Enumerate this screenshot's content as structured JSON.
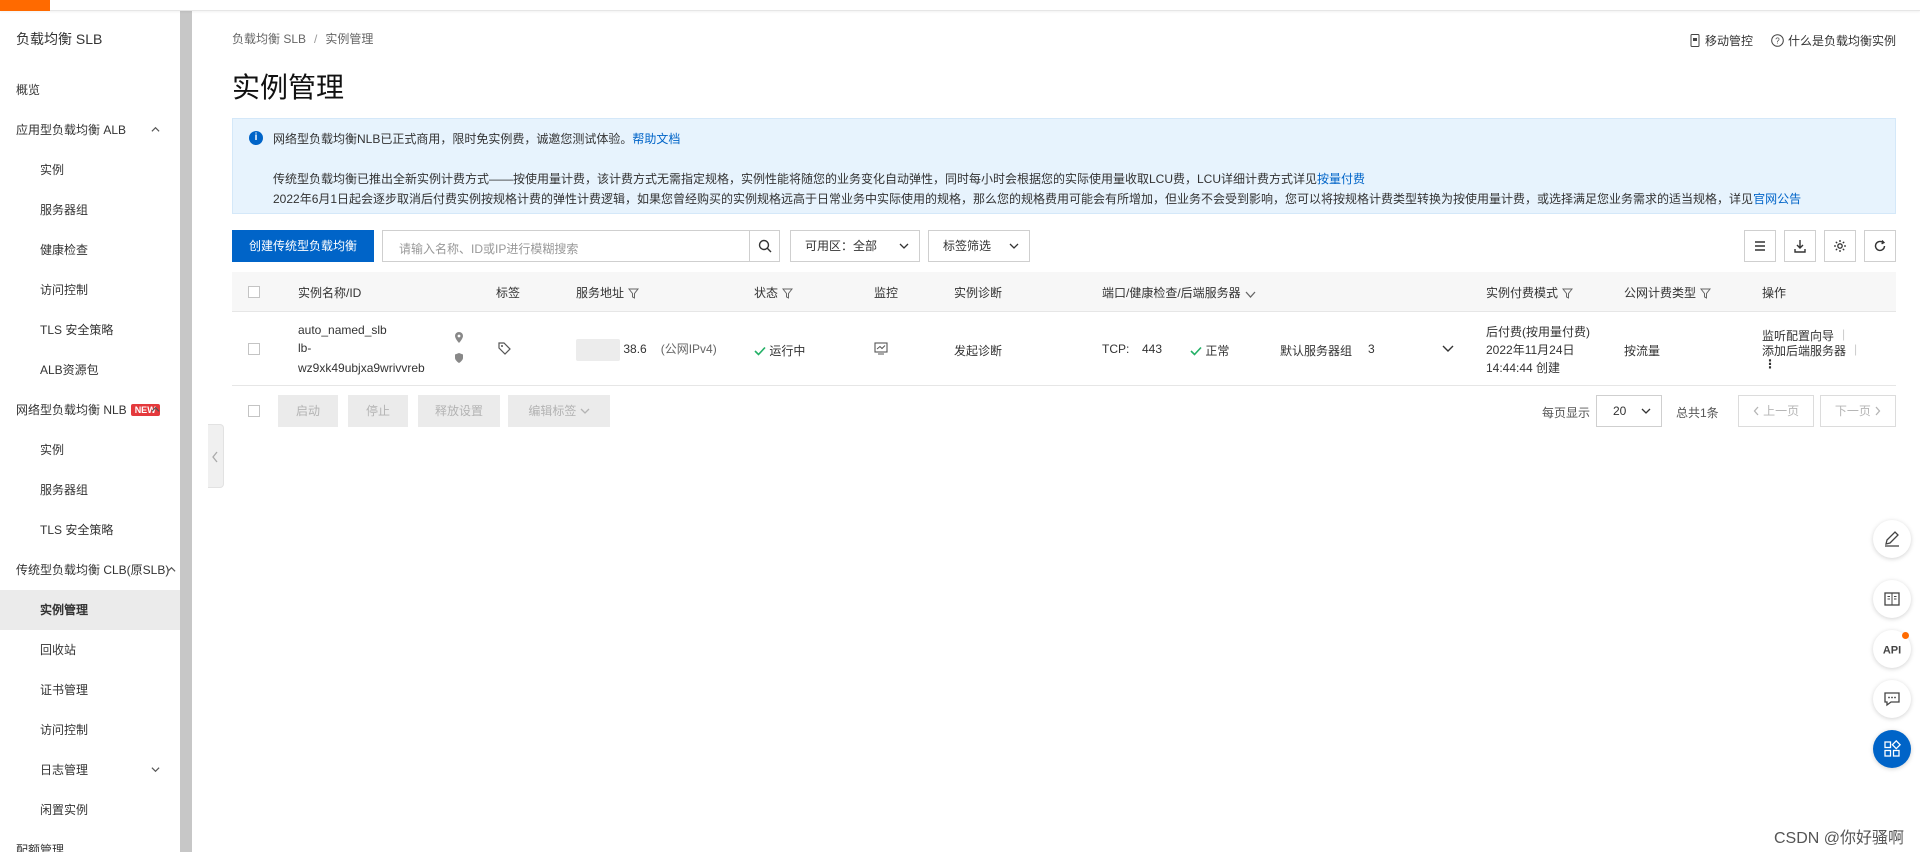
{
  "sidebar": {
    "title": "负载均衡 SLB",
    "items": [
      {
        "label": "概览",
        "type": "group"
      },
      {
        "label": "应用型负载均衡 ALB",
        "type": "group",
        "chevron": "up"
      },
      {
        "label": "实例",
        "type": "sub"
      },
      {
        "label": "服务器组",
        "type": "sub"
      },
      {
        "label": "健康检查",
        "type": "sub"
      },
      {
        "label": "访问控制",
        "type": "sub"
      },
      {
        "label": "TLS 安全策略",
        "type": "sub"
      },
      {
        "label": "ALB资源包",
        "type": "sub"
      },
      {
        "label": "网络型负载均衡 NLB",
        "type": "group",
        "chevron": "up",
        "badge": "NEW"
      },
      {
        "label": "实例",
        "type": "sub"
      },
      {
        "label": "服务器组",
        "type": "sub"
      },
      {
        "label": "TLS 安全策略",
        "type": "sub"
      },
      {
        "label": "传统型负载均衡 CLB(原SLB)",
        "type": "group",
        "chevron": "up"
      },
      {
        "label": "实例管理",
        "type": "sub",
        "active": true
      },
      {
        "label": "回收站",
        "type": "sub"
      },
      {
        "label": "证书管理",
        "type": "sub"
      },
      {
        "label": "访问控制",
        "type": "sub"
      },
      {
        "label": "日志管理",
        "type": "sub",
        "chevron": "down"
      },
      {
        "label": "闲置实例",
        "type": "sub"
      },
      {
        "label": "配额管理",
        "type": "group"
      }
    ]
  },
  "breadcrumb": {
    "root": "负载均衡 SLB",
    "separator": "/",
    "current": "实例管理"
  },
  "top_links": {
    "mobile": "移动管控",
    "what_is": "什么是负载均衡实例"
  },
  "page_title": "实例管理",
  "notice": {
    "line1": "网络型负载均衡NLB已正式商用，限时免实例费，诚邀您测试体验。",
    "line1_link": "帮助文档",
    "line2": "传统型负载均衡已推出全新实例计费方式——按使用量计费，该计费方式无需指定规格，实例性能将随您的业务变化自动弹性，同时每小时会根据您的实际使用量收取LCU费，LCU详细计费方式详见",
    "line2_link": "按量付费",
    "line3": "2022年6月1日起会逐步取消后付费实例按规格计费的弹性计费逻辑，如果您曾经购买的实例规格远高于日常业务中实际使用的规格，那么您的规格费用可能会有所增加，但业务不会受到影响，您可以将按规格计费类型转换为按使用量计费，或选择满足您业务需求的适当规格，详见",
    "line3_link": "官网公告"
  },
  "toolbar": {
    "create": "创建传统型负载均衡",
    "search_placeholder": "请输入名称、ID或IP进行模糊搜索",
    "zone": "可用区：全部",
    "tag_filter": "标签筛选"
  },
  "table": {
    "headers": {
      "name": "实例名称/ID",
      "tag": "标签",
      "address": "服务地址",
      "status": "状态",
      "monitor": "监控",
      "diagnose": "实例诊断",
      "port": "端口/健康检查/后端服务器",
      "billing": "实例付费模式",
      "net_billing": "公网计费类型",
      "ops": "操作"
    },
    "row": {
      "name": "auto_named_slb",
      "id_line1": "lb-",
      "id_line2": "wz9xk49ubjxa9wrivvreb",
      "address": "38.6",
      "address_type": "(公网IPv4)",
      "status": "运行中",
      "diagnose": "发起诊断",
      "protocol": "TCP:",
      "port": "443",
      "health": "正常",
      "server_group": "默认服务器组",
      "server_count": "3",
      "billing_mode": "后付费(按用量付费)",
      "created_date": "2022年11月24日",
      "created_time": "14:44:44 创建",
      "net_billing": "按流量",
      "op1": "监听配置向导",
      "op2": "添加后端服务器",
      "more": "⋮"
    }
  },
  "footer": {
    "start": "启动",
    "stop": "停止",
    "release": "释放设置",
    "edit_tags": "编辑标签",
    "per_page_label": "每页显示",
    "per_page": "20",
    "total": "总共1条",
    "prev": "上一页",
    "next": "下一页"
  },
  "watermark": "CSDN @你好骚啊",
  "colors": {
    "primary": "#0064c8",
    "brand": "#ff6a00",
    "success": "#23b066"
  }
}
